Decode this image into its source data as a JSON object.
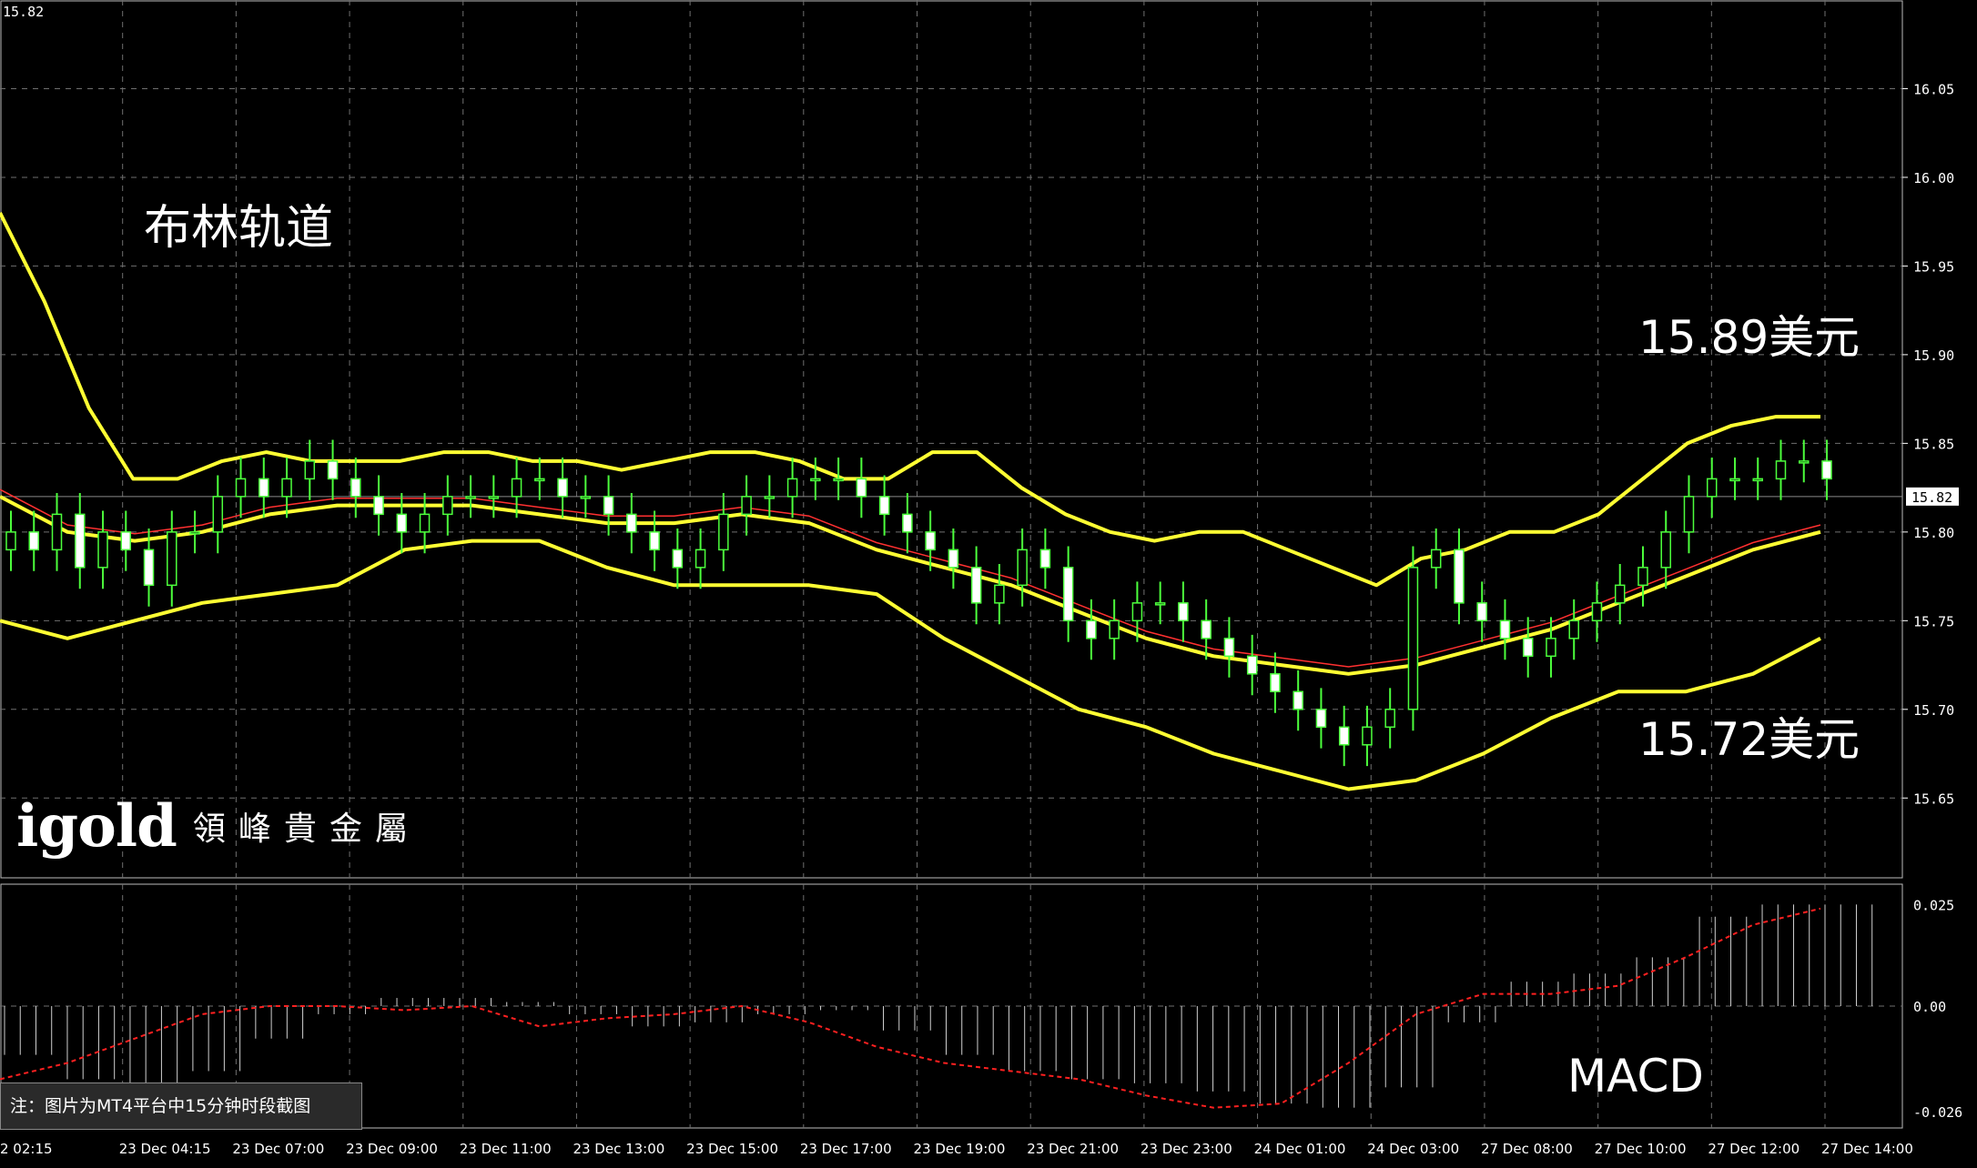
{
  "corner_price": "15.82",
  "title": "布林轨道",
  "annotations": {
    "upper_price": "15.89美元",
    "lower_price": "15.72美元",
    "macd_label": "MACD"
  },
  "note": "注：图片为MT4平台中15分钟时段截图",
  "logo": {
    "main": "igold",
    "sub": "領峰貴金屬"
  },
  "colors": {
    "background": "#000000",
    "grid": "#6f6f6f",
    "bullish_candle": "#4cff3c",
    "bearish_candle": "#ffffff",
    "bollinger": "#ffff33",
    "middle_line": "#ff3030",
    "current_price_line": "#8a8a8a",
    "macd_signal": "#ff2020",
    "macd_histogram": "#d0d0d0"
  },
  "chart_data": [
    {
      "type": "candlestick",
      "title": "布林轨道",
      "indicator": "Bollinger Bands",
      "ylim": [
        15.605,
        16.1
      ],
      "y_ticks": [
        "16.05",
        "16.00",
        "15.95",
        "15.90",
        "15.85",
        "15.80",
        "15.75",
        "15.70",
        "15.65"
      ],
      "current_price": "15.82",
      "x_ticks": [
        "2 02:15",
        "23 Dec 04:15",
        "23 Dec 07:00",
        "23 Dec 09:00",
        "23 Dec 11:00",
        "23 Dec 13:00",
        "23 Dec 15:00",
        "23 Dec 17:00",
        "23 Dec 19:00",
        "23 Dec 21:00",
        "23 Dec 23:00",
        "24 Dec 01:00",
        "24 Dec 03:00",
        "27 Dec 08:00",
        "27 Dec 10:00",
        "27 Dec 12:00",
        "27 Dec 14:00"
      ],
      "close_series": [
        15.8,
        15.79,
        15.81,
        15.78,
        15.8,
        15.79,
        15.77,
        15.8,
        15.8,
        15.82,
        15.83,
        15.82,
        15.83,
        15.84,
        15.83,
        15.82,
        15.81,
        15.8,
        15.81,
        15.82,
        15.82,
        15.82,
        15.83,
        15.83,
        15.82,
        15.82,
        15.81,
        15.8,
        15.79,
        15.78,
        15.79,
        15.81,
        15.82,
        15.82,
        15.83,
        15.83,
        15.83,
        15.82,
        15.81,
        15.8,
        15.79,
        15.78,
        15.76,
        15.77,
        15.79,
        15.78,
        15.75,
        15.74,
        15.75,
        15.76,
        15.76,
        15.75,
        15.74,
        15.73,
        15.72,
        15.71,
        15.7,
        15.69,
        15.68,
        15.69,
        15.7,
        15.78,
        15.79,
        15.76,
        15.75,
        15.74,
        15.73,
        15.74,
        15.75,
        15.76,
        15.77,
        15.78,
        15.8,
        15.82,
        15.83,
        15.83,
        15.83,
        15.84,
        15.84,
        15.83
      ],
      "bollinger_upper": [
        15.98,
        15.93,
        15.87,
        15.83,
        15.83,
        15.84,
        15.845,
        15.84,
        15.84,
        15.84,
        15.845,
        15.845,
        15.84,
        15.84,
        15.835,
        15.84,
        15.845,
        15.845,
        15.84,
        15.83,
        15.83,
        15.845,
        15.845,
        15.825,
        15.81,
        15.8,
        15.795,
        15.8,
        15.8,
        15.79,
        15.78,
        15.77,
        15.785,
        15.79,
        15.8,
        15.8,
        15.81,
        15.83,
        15.85,
        15.86,
        15.865,
        15.865
      ],
      "bollinger_middle": [
        15.82,
        15.8,
        15.795,
        15.8,
        15.81,
        15.815,
        15.815,
        15.815,
        15.81,
        15.805,
        15.805,
        15.81,
        15.805,
        15.79,
        15.78,
        15.77,
        15.755,
        15.74,
        15.73,
        15.725,
        15.72,
        15.725,
        15.735,
        15.745,
        15.76,
        15.775,
        15.79,
        15.8
      ],
      "bollinger_lower": [
        15.75,
        15.74,
        15.75,
        15.76,
        15.765,
        15.77,
        15.79,
        15.795,
        15.795,
        15.78,
        15.77,
        15.77,
        15.77,
        15.765,
        15.74,
        15.72,
        15.7,
        15.69,
        15.675,
        15.665,
        15.655,
        15.66,
        15.675,
        15.695,
        15.71,
        15.71,
        15.72,
        15.74
      ]
    },
    {
      "type": "bar",
      "title": "MACD",
      "ylim": [
        -0.03,
        0.03
      ],
      "y_ticks": [
        "0.025",
        "0.00",
        "-0.026"
      ],
      "histogram": [
        -0.012,
        -0.018,
        -0.02,
        -0.016,
        -0.008,
        -0.002,
        0.002,
        0.002,
        0.001,
        -0.002,
        -0.005,
        -0.004,
        -0.002,
        -0.001,
        -0.006,
        -0.012,
        -0.016,
        -0.018,
        -0.019,
        -0.021,
        -0.024,
        -0.025,
        -0.02,
        -0.004,
        0.006,
        0.008,
        0.012,
        0.022,
        0.025,
        0.025
      ],
      "signal": [
        -0.018,
        -0.014,
        -0.008,
        -0.002,
        0.0,
        0.0,
        -0.001,
        0.0,
        -0.005,
        -0.003,
        -0.002,
        0.0,
        -0.004,
        -0.01,
        -0.014,
        -0.016,
        -0.018,
        -0.022,
        -0.025,
        -0.024,
        -0.014,
        -0.002,
        0.003,
        0.003,
        0.005,
        0.012,
        0.02,
        0.024
      ]
    }
  ]
}
